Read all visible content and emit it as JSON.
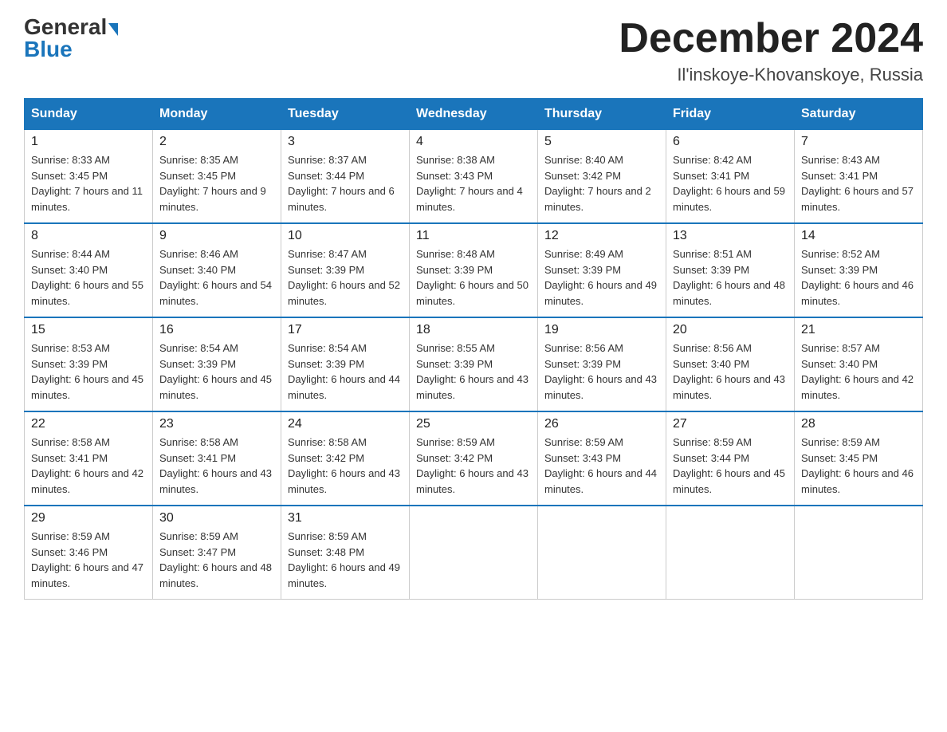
{
  "header": {
    "logo_general": "General",
    "logo_blue": "Blue",
    "month_title": "December 2024",
    "location": "Il'inskoye-Khovanskoye, Russia"
  },
  "days_of_week": [
    "Sunday",
    "Monday",
    "Tuesday",
    "Wednesday",
    "Thursday",
    "Friday",
    "Saturday"
  ],
  "weeks": [
    [
      {
        "day": "1",
        "sunrise": "8:33 AM",
        "sunset": "3:45 PM",
        "daylight": "7 hours and 11 minutes."
      },
      {
        "day": "2",
        "sunrise": "8:35 AM",
        "sunset": "3:45 PM",
        "daylight": "7 hours and 9 minutes."
      },
      {
        "day": "3",
        "sunrise": "8:37 AM",
        "sunset": "3:44 PM",
        "daylight": "7 hours and 6 minutes."
      },
      {
        "day": "4",
        "sunrise": "8:38 AM",
        "sunset": "3:43 PM",
        "daylight": "7 hours and 4 minutes."
      },
      {
        "day": "5",
        "sunrise": "8:40 AM",
        "sunset": "3:42 PM",
        "daylight": "7 hours and 2 minutes."
      },
      {
        "day": "6",
        "sunrise": "8:42 AM",
        "sunset": "3:41 PM",
        "daylight": "6 hours and 59 minutes."
      },
      {
        "day": "7",
        "sunrise": "8:43 AM",
        "sunset": "3:41 PM",
        "daylight": "6 hours and 57 minutes."
      }
    ],
    [
      {
        "day": "8",
        "sunrise": "8:44 AM",
        "sunset": "3:40 PM",
        "daylight": "6 hours and 55 minutes."
      },
      {
        "day": "9",
        "sunrise": "8:46 AM",
        "sunset": "3:40 PM",
        "daylight": "6 hours and 54 minutes."
      },
      {
        "day": "10",
        "sunrise": "8:47 AM",
        "sunset": "3:39 PM",
        "daylight": "6 hours and 52 minutes."
      },
      {
        "day": "11",
        "sunrise": "8:48 AM",
        "sunset": "3:39 PM",
        "daylight": "6 hours and 50 minutes."
      },
      {
        "day": "12",
        "sunrise": "8:49 AM",
        "sunset": "3:39 PM",
        "daylight": "6 hours and 49 minutes."
      },
      {
        "day": "13",
        "sunrise": "8:51 AM",
        "sunset": "3:39 PM",
        "daylight": "6 hours and 48 minutes."
      },
      {
        "day": "14",
        "sunrise": "8:52 AM",
        "sunset": "3:39 PM",
        "daylight": "6 hours and 46 minutes."
      }
    ],
    [
      {
        "day": "15",
        "sunrise": "8:53 AM",
        "sunset": "3:39 PM",
        "daylight": "6 hours and 45 minutes."
      },
      {
        "day": "16",
        "sunrise": "8:54 AM",
        "sunset": "3:39 PM",
        "daylight": "6 hours and 45 minutes."
      },
      {
        "day": "17",
        "sunrise": "8:54 AM",
        "sunset": "3:39 PM",
        "daylight": "6 hours and 44 minutes."
      },
      {
        "day": "18",
        "sunrise": "8:55 AM",
        "sunset": "3:39 PM",
        "daylight": "6 hours and 43 minutes."
      },
      {
        "day": "19",
        "sunrise": "8:56 AM",
        "sunset": "3:39 PM",
        "daylight": "6 hours and 43 minutes."
      },
      {
        "day": "20",
        "sunrise": "8:56 AM",
        "sunset": "3:40 PM",
        "daylight": "6 hours and 43 minutes."
      },
      {
        "day": "21",
        "sunrise": "8:57 AM",
        "sunset": "3:40 PM",
        "daylight": "6 hours and 42 minutes."
      }
    ],
    [
      {
        "day": "22",
        "sunrise": "8:58 AM",
        "sunset": "3:41 PM",
        "daylight": "6 hours and 42 minutes."
      },
      {
        "day": "23",
        "sunrise": "8:58 AM",
        "sunset": "3:41 PM",
        "daylight": "6 hours and 43 minutes."
      },
      {
        "day": "24",
        "sunrise": "8:58 AM",
        "sunset": "3:42 PM",
        "daylight": "6 hours and 43 minutes."
      },
      {
        "day": "25",
        "sunrise": "8:59 AM",
        "sunset": "3:42 PM",
        "daylight": "6 hours and 43 minutes."
      },
      {
        "day": "26",
        "sunrise": "8:59 AM",
        "sunset": "3:43 PM",
        "daylight": "6 hours and 44 minutes."
      },
      {
        "day": "27",
        "sunrise": "8:59 AM",
        "sunset": "3:44 PM",
        "daylight": "6 hours and 45 minutes."
      },
      {
        "day": "28",
        "sunrise": "8:59 AM",
        "sunset": "3:45 PM",
        "daylight": "6 hours and 46 minutes."
      }
    ],
    [
      {
        "day": "29",
        "sunrise": "8:59 AM",
        "sunset": "3:46 PM",
        "daylight": "6 hours and 47 minutes."
      },
      {
        "day": "30",
        "sunrise": "8:59 AM",
        "sunset": "3:47 PM",
        "daylight": "6 hours and 48 minutes."
      },
      {
        "day": "31",
        "sunrise": "8:59 AM",
        "sunset": "3:48 PM",
        "daylight": "6 hours and 49 minutes."
      },
      null,
      null,
      null,
      null
    ]
  ]
}
